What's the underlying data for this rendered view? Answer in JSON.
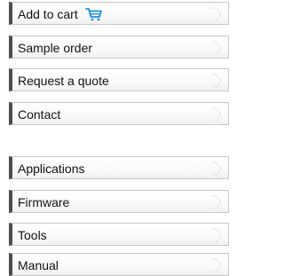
{
  "accent_color": "#1a8fe0",
  "group1": [
    {
      "label": "Add to cart",
      "icon": "cart-icon"
    },
    {
      "label": "Sample order"
    },
    {
      "label": "Request a quote"
    },
    {
      "label": "Contact"
    }
  ],
  "group2": [
    {
      "label": "Applications"
    },
    {
      "label": "Firmware"
    },
    {
      "label": "Tools"
    },
    {
      "label": "Manual"
    }
  ]
}
